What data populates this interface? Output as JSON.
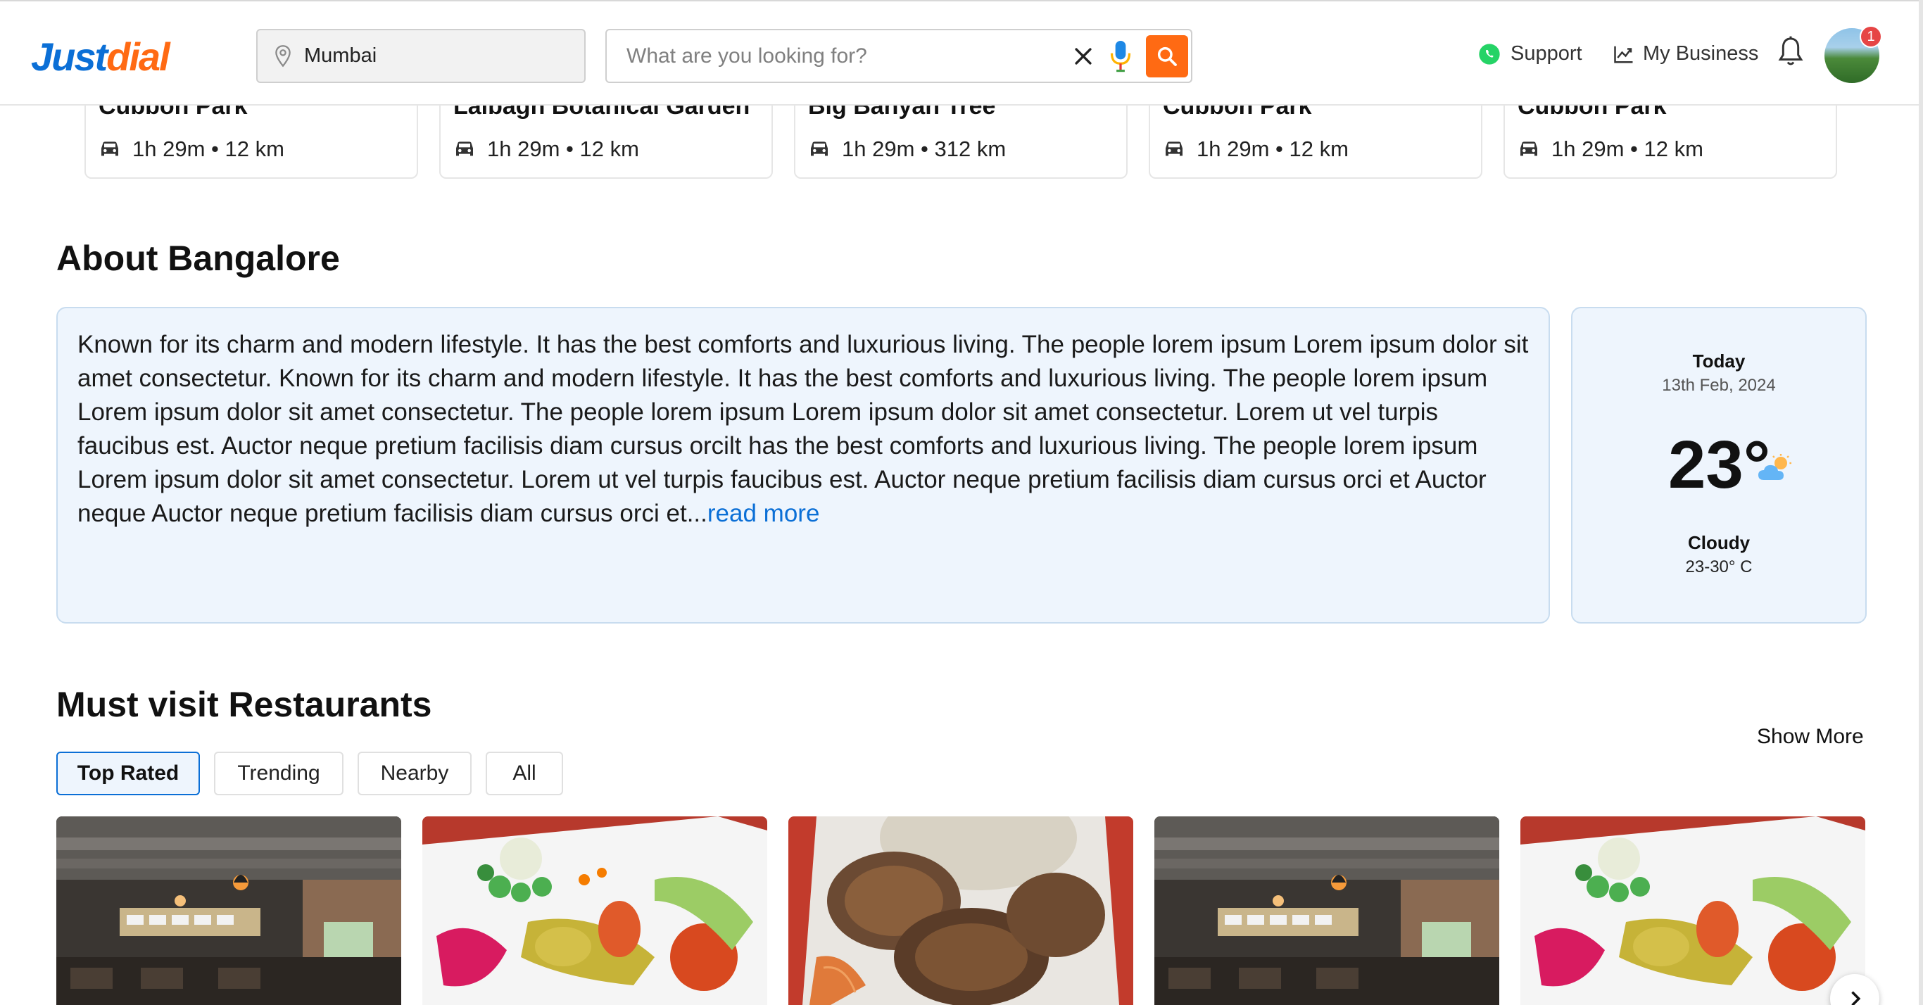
{
  "header": {
    "logo_part1": "Just",
    "logo_part2": "dial",
    "location_value": "Mumbai",
    "search_placeholder": "What are you looking for?",
    "support_label": "Support",
    "my_business_label": "My Business",
    "notification_count": "1"
  },
  "places": [
    {
      "name": "Cubbon Park",
      "meta": "1h 29m • 12 km"
    },
    {
      "name": "Lalbagh Botanical Garden",
      "meta": "1h 29m • 12 km"
    },
    {
      "name": "Big Banyan Tree",
      "meta": "1h 29m • 312 km"
    },
    {
      "name": "Cubbon Park",
      "meta": "1h 29m • 12 km"
    },
    {
      "name": "Cubbon Park",
      "meta": "1h 29m • 12 km"
    }
  ],
  "about": {
    "title": "About Bangalore",
    "text": "Known for its charm and modern lifestyle. It has the best comforts and luxurious living. The people lorem ipsum Lorem ipsum dolor sit amet consectetur. Known for its charm and modern lifestyle. It has the best comforts and luxurious living. The people lorem ipsum Lorem ipsum dolor sit amet consectetur. The people lorem ipsum Lorem ipsum dolor sit amet consectetur. Lorem ut vel turpis faucibus est. Auctor neque pretium facilisis diam cursus orcilt has the best comforts and luxurious living. The people lorem ipsum Lorem ipsum dolor sit amet consectetur. Lorem ut vel turpis faucibus est. Auctor neque pretium facilisis diam cursus orci et Auctor neque Auctor neque pretium facilisis diam cursus orci et...",
    "read_more": "read more"
  },
  "weather": {
    "day": "Today",
    "date": "13th Feb, 2024",
    "temp": "23°",
    "condition": "Cloudy",
    "range": "23-30° C"
  },
  "restaurants": {
    "title": "Must visit Restaurants",
    "show_more": "Show More",
    "tabs": [
      "Top Rated",
      "Trending",
      "Nearby",
      "All"
    ],
    "active_tab": "Top Rated"
  },
  "colors": {
    "brand_blue": "#0b6fd6",
    "brand_orange": "#ff6a13",
    "panel_bg": "#eef5fd"
  }
}
